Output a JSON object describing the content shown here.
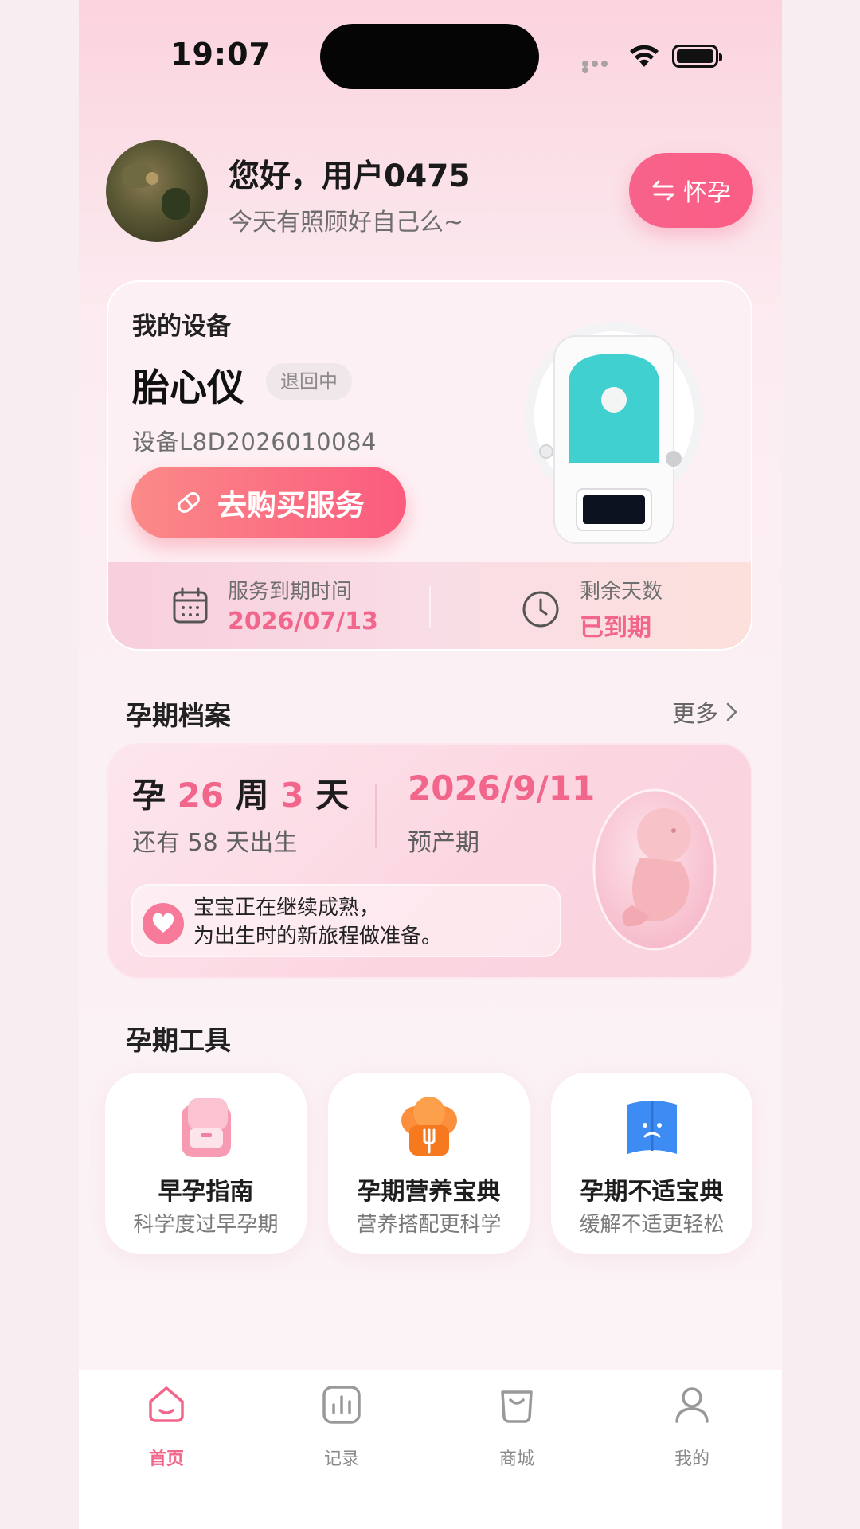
{
  "status_bar": {
    "time": "19:07"
  },
  "greeting": {
    "title": "您好，用户0475",
    "subtitle": "今天有照顾好自己么~",
    "switch_label": "怀孕"
  },
  "device": {
    "section_label": "我的设备",
    "name": "胎心仪",
    "status_badge": "退回中",
    "serial": "设备L8D2026010084",
    "buy_button": "去购买服务",
    "expiry_label": "服务到期时间",
    "expiry_value": "2026/07/13",
    "remaining_label": "剩余天数",
    "remaining_value": "已到期"
  },
  "profile": {
    "section_title": "孕期档案",
    "more_label": "更多",
    "week_prefix": "孕",
    "weeks": "26",
    "week_unit": "周",
    "days": "3",
    "day_unit": "天",
    "days_left": "还有 58 天出生",
    "due_date": "2026/9/11",
    "due_label": "预产期",
    "tip_line1": "宝宝正在继续成熟，",
    "tip_line2": "为出生时的新旅程做准备。"
  },
  "tools": {
    "section_title": "孕期工具",
    "items": [
      {
        "name": "早孕指南",
        "desc": "科学度过早孕期",
        "icon": "pink-backpack-icon"
      },
      {
        "name": "孕期营养宝典",
        "desc": "营养搭配更科学",
        "icon": "chef-hat-icon"
      },
      {
        "name": "孕期不适宝典",
        "desc": "缓解不适更轻松",
        "icon": "blue-book-icon"
      }
    ]
  },
  "tabbar": {
    "items": [
      {
        "label": "首页",
        "icon": "home-icon",
        "active": true
      },
      {
        "label": "记录",
        "icon": "chart-icon",
        "active": false
      },
      {
        "label": "商城",
        "icon": "shopping-bag-icon",
        "active": false
      },
      {
        "label": "我的",
        "icon": "person-icon",
        "active": false
      }
    ]
  },
  "colors": {
    "accent": "#f2668b",
    "button": "#fa5d86"
  }
}
